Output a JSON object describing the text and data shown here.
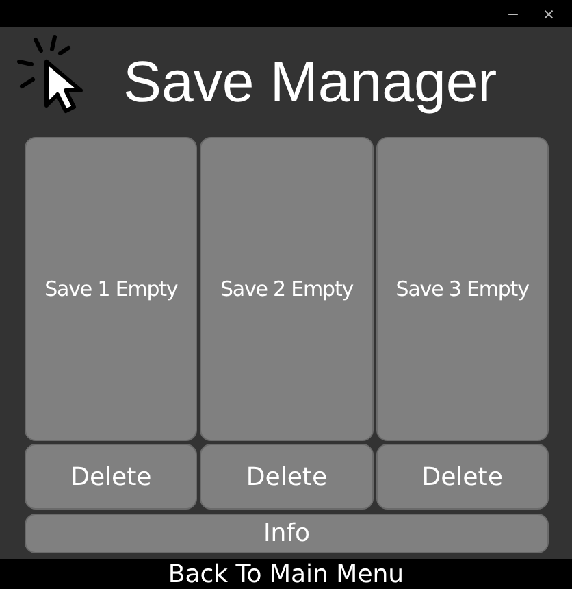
{
  "window": {
    "controls": [
      "−",
      "×"
    ]
  },
  "title": "Save Manager",
  "slots": [
    {
      "label": "Save 1 Empty",
      "delete": "Delete"
    },
    {
      "label": "Save 2 Empty",
      "delete": "Delete"
    },
    {
      "label": "Save 3 Empty",
      "delete": "Delete"
    }
  ],
  "info_button": "Info",
  "back_button": "Back To Main Menu"
}
